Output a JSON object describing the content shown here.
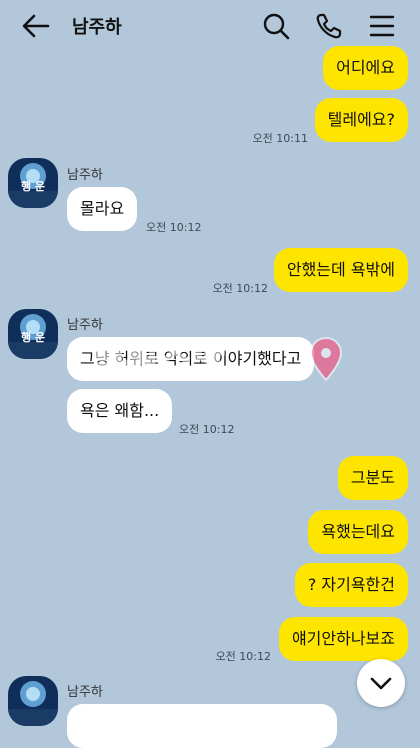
{
  "header": {
    "title": "남주하",
    "back_icon": "arrow-left-icon",
    "search_icon": "search-icon",
    "call_icon": "phone-icon",
    "menu_icon": "menu-icon"
  },
  "messages": {
    "m1": {
      "text": "어디에요"
    },
    "m2": {
      "text": "텔레에요?",
      "time": "오전 10:11"
    },
    "s1": {
      "sender": "남주하"
    },
    "m3": {
      "text": "몰라요",
      "time": "오전 10:12"
    },
    "m4": {
      "text": "안했는데 욕밖에",
      "time": "오전 10:12"
    },
    "s2": {
      "sender": "남주하"
    },
    "m5": {
      "text": "그냥 허위로 악의로 이야기했다고"
    },
    "m6": {
      "text": "욕은 왜함...",
      "time": "오전 10:12"
    },
    "m7": {
      "text": "그분도"
    },
    "m8": {
      "text": "욕했는데요"
    },
    "m9": {
      "text": "? 자기욕한건"
    },
    "m10": {
      "text": "얘기안하나보죠",
      "time": "오전 10:12"
    },
    "s3": {
      "sender": "남주하"
    }
  },
  "watermark": {
    "text": "먹튀스팟"
  },
  "colors": {
    "background": "#b2c7da",
    "my_bubble": "#fee500",
    "their_bubble": "#ffffff"
  }
}
